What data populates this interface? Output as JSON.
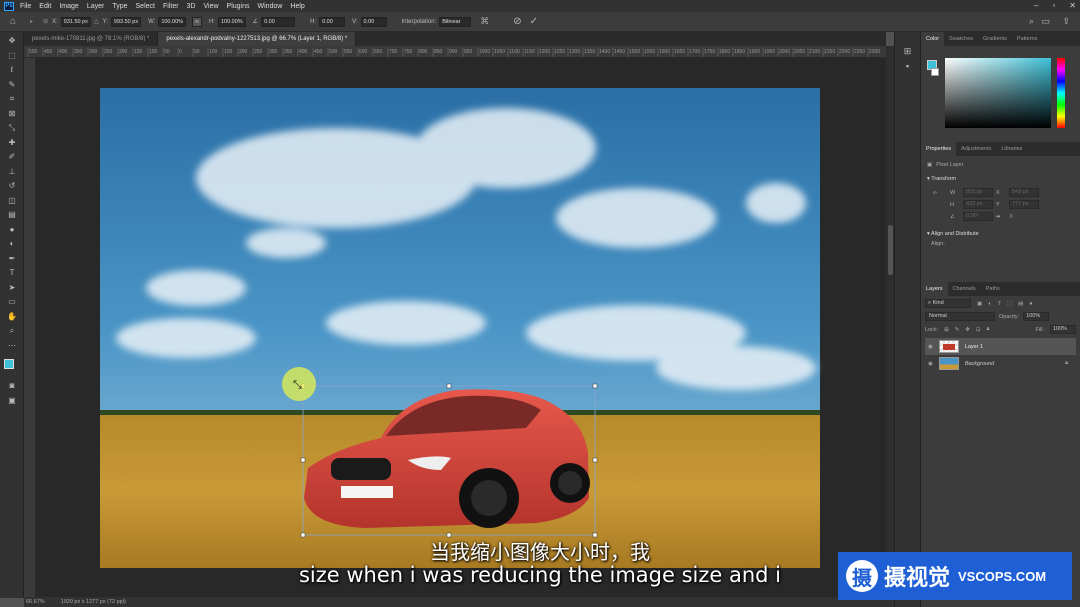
{
  "menubar": {
    "logo": "Ps",
    "items": [
      "File",
      "Edit",
      "Image",
      "Layer",
      "Type",
      "Select",
      "Filter",
      "3D",
      "View",
      "Plugins",
      "Window",
      "Help"
    ]
  },
  "options": {
    "x_label": "X:",
    "x_value": "931.50 px",
    "y_label": "Y:",
    "y_value": "993.50 px",
    "w_label": "W:",
    "w_value": "100.00%",
    "h_label": "H:",
    "h_value": "100.00%",
    "angle_value": "0.00",
    "hskew_label": "H:",
    "hskew_value": "0.00",
    "vskew_label": "V:",
    "vskew_value": "0.00",
    "interp_label": "Interpolation:",
    "interp_value": "Bilinear"
  },
  "tabs": [
    {
      "label": "pexels-mike-170811.jpg @ 78.1% (RGB/8) *"
    },
    {
      "label": "pexels-alexandr-podvalny-1227513.jpg @ 66.7% (Layer 1, RGB/8) *"
    }
  ],
  "ruler_top": [
    "500",
    "450",
    "400",
    "350",
    "300",
    "250",
    "200",
    "150",
    "100",
    "50",
    "0",
    "50",
    "100",
    "150",
    "200",
    "250",
    "300",
    "350",
    "400",
    "450",
    "500",
    "550",
    "600",
    "650",
    "700",
    "750",
    "800",
    "850",
    "900",
    "950",
    "1000",
    "1050",
    "1100",
    "1150",
    "1200",
    "1250",
    "1300",
    "1350",
    "1400",
    "1450",
    "1500",
    "1550",
    "1600",
    "1650",
    "1700",
    "1750",
    "1800",
    "1850",
    "1900",
    "1950",
    "2000",
    "2050",
    "2100",
    "2150",
    "2200",
    "2250",
    "2300"
  ],
  "status": {
    "zoom": "66.67%",
    "doc": "1920 px x 1277 px (72 ppi)"
  },
  "color_panel": {
    "tabs": [
      "Color",
      "Swatches",
      "Gradients",
      "Patterns"
    ],
    "fg": "#3ec1d8"
  },
  "properties": {
    "tabs": [
      "Properties",
      "Adjustments",
      "Libraries"
    ],
    "layer_type": "Pixel Layer",
    "transform_title": "Transform",
    "w_label": "W",
    "w_value": "955 px",
    "x_label": "X",
    "x_value": "549 px",
    "h_label": "H",
    "h_value": "433 px",
    "y_label": "Y",
    "y_value": "777 px",
    "angle_value": "0.00°",
    "align_title": "Align and Distribute",
    "align_label": "Align:"
  },
  "layers": {
    "tabs": [
      "Layers",
      "Channels",
      "Paths"
    ],
    "kind_label": "Kind",
    "blend": "Normal",
    "opacity_label": "Opacity:",
    "opacity_value": "100%",
    "lock_label": "Lock:",
    "fill_label": "Fill:",
    "fill_value": "100%",
    "items": [
      {
        "name": "Layer 1"
      },
      {
        "name": "Background"
      }
    ]
  },
  "subtitle": {
    "cn": "当我缩小图像大小时，我",
    "en": "size when i was reducing the image size and i"
  },
  "brand": {
    "name": "摄视觉",
    "url": "VSCOPS.COM",
    "icon": "摄"
  }
}
